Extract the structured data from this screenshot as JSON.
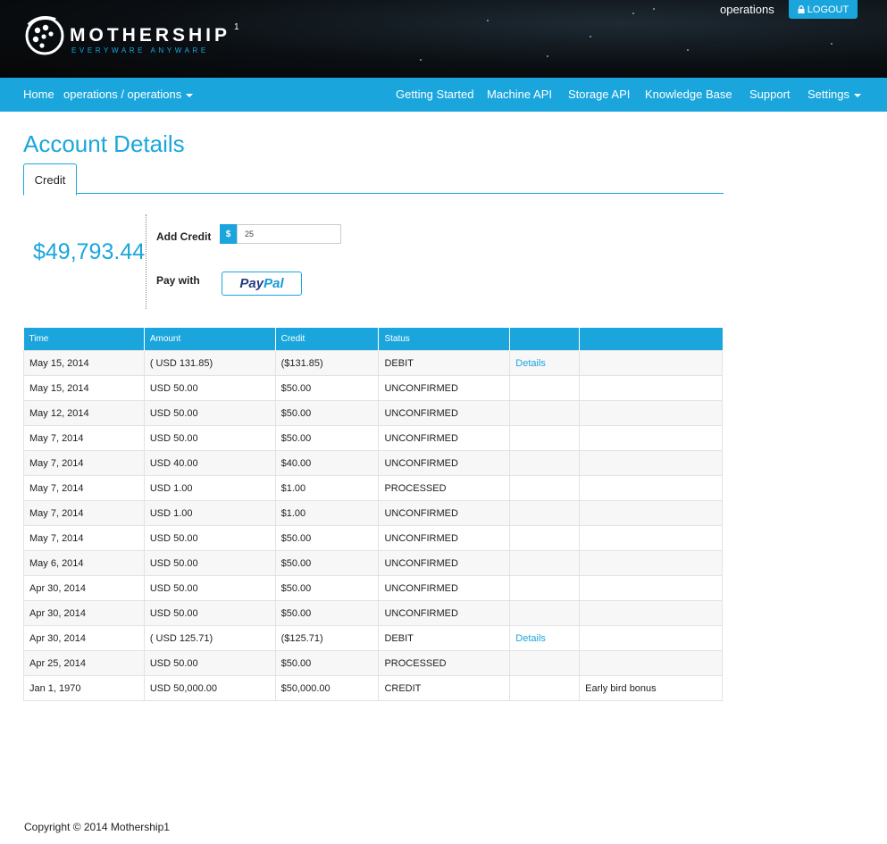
{
  "header": {
    "brand_name": "MOTHERSHIP",
    "brand_sup": "1",
    "brand_tagline": "EVERYWARE ANYWARE",
    "user_name": "operations",
    "logout_label": "LOGOUT",
    "logout_icon": "lock-icon",
    "accent_color": "#1aa6dd"
  },
  "nav": {
    "home": "Home",
    "account": "operations / operations",
    "getting_started": "Getting Started",
    "machine_api": "Machine API",
    "storage_api": "Storage API",
    "knowledge_base": "Knowledge Base",
    "support": "Support",
    "settings": "Settings"
  },
  "page": {
    "title": "Account Details",
    "tab_credit": "Credit"
  },
  "credit": {
    "balance": "$49,793.44",
    "add_credit_label": "Add Credit",
    "currency_symbol": "$",
    "amount_value": "25",
    "pay_with_label": "Pay with",
    "paypal_part1": "Pay",
    "paypal_part2": "Pal"
  },
  "table": {
    "headers": [
      "Time",
      "Amount",
      "Credit",
      "Status",
      "",
      ""
    ],
    "rows": [
      {
        "time": "May 15, 2014",
        "amount": "( USD 131.85)",
        "credit": "($131.85)",
        "status": "DEBIT",
        "link": "Details",
        "note": ""
      },
      {
        "time": "May 15, 2014",
        "amount": "USD 50.00",
        "credit": "$50.00",
        "status": "UNCONFIRMED",
        "link": "",
        "note": ""
      },
      {
        "time": "May 12, 2014",
        "amount": "USD 50.00",
        "credit": "$50.00",
        "status": "UNCONFIRMED",
        "link": "",
        "note": ""
      },
      {
        "time": "May 7, 2014",
        "amount": "USD 50.00",
        "credit": "$50.00",
        "status": "UNCONFIRMED",
        "link": "",
        "note": ""
      },
      {
        "time": "May 7, 2014",
        "amount": "USD 40.00",
        "credit": "$40.00",
        "status": "UNCONFIRMED",
        "link": "",
        "note": ""
      },
      {
        "time": "May 7, 2014",
        "amount": "USD 1.00",
        "credit": "$1.00",
        "status": "PROCESSED",
        "link": "",
        "note": ""
      },
      {
        "time": "May 7, 2014",
        "amount": "USD 1.00",
        "credit": "$1.00",
        "status": "UNCONFIRMED",
        "link": "",
        "note": ""
      },
      {
        "time": "May 7, 2014",
        "amount": "USD 50.00",
        "credit": "$50.00",
        "status": "UNCONFIRMED",
        "link": "",
        "note": ""
      },
      {
        "time": "May 6, 2014",
        "amount": "USD 50.00",
        "credit": "$50.00",
        "status": "UNCONFIRMED",
        "link": "",
        "note": ""
      },
      {
        "time": "Apr 30, 2014",
        "amount": "USD 50.00",
        "credit": "$50.00",
        "status": "UNCONFIRMED",
        "link": "",
        "note": ""
      },
      {
        "time": "Apr 30, 2014",
        "amount": "USD 50.00",
        "credit": "$50.00",
        "status": "UNCONFIRMED",
        "link": "",
        "note": ""
      },
      {
        "time": "Apr 30, 2014",
        "amount": "( USD 125.71)",
        "credit": "($125.71)",
        "status": "DEBIT",
        "link": "Details",
        "note": ""
      },
      {
        "time": "Apr 25, 2014",
        "amount": "USD 50.00",
        "credit": "$50.00",
        "status": "PROCESSED",
        "link": "",
        "note": ""
      },
      {
        "time": "Jan 1, 1970",
        "amount": "USD 50,000.00",
        "credit": "$50,000.00",
        "status": "CREDIT",
        "link": "",
        "note": "Early bird bonus"
      }
    ]
  },
  "footer": {
    "copyright": "Copyright © 2014 Mothership1"
  }
}
